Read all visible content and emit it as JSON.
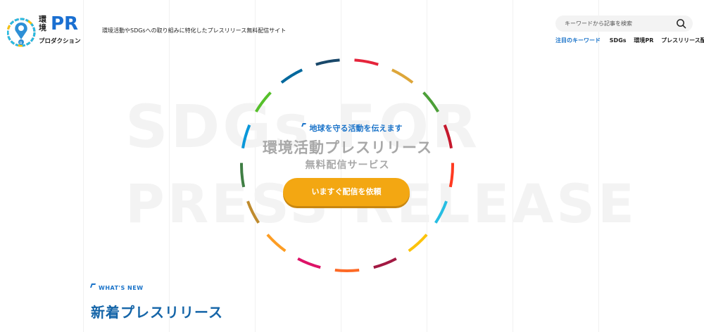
{
  "header": {
    "logo_text_top": "環境",
    "logo_text_pr": "PR",
    "logo_text_bottom": "プロダクション",
    "tagline": "環境活動やSDGsへの取り組みに特化したプレスリリース無料配信サイト",
    "search_placeholder": "キーワードから記事を検索",
    "keywords_label": "注目のキーワード",
    "keywords": [
      "SDGs",
      "環境PR",
      "プレスリリース配信"
    ]
  },
  "hero": {
    "background_words": [
      "SDGs FOR",
      "PRESS RELEASE"
    ],
    "subtitle": "地球を守る活動を伝えます",
    "title": "環境活動プレスリリース",
    "title_sub": "無料配信サービス",
    "cta_label": "いますぐ配信を依頼",
    "ring_colors": [
      "#e5243b",
      "#dda63a",
      "#4c9f38",
      "#c5192d",
      "#ff3a21",
      "#26bde2",
      "#fcc30b",
      "#a21942",
      "#fd6925",
      "#dd1367",
      "#fd9d24",
      "#bf8b2e",
      "#3f7e44",
      "#0a97d9",
      "#56c02b",
      "#00689d",
      "#19486a"
    ]
  },
  "whats_new": {
    "label": "WHAT'S NEW",
    "title": "新着プレスリリース"
  },
  "colors": {
    "accent_blue": "#1a73c9",
    "cta_orange": "#f3a712"
  }
}
